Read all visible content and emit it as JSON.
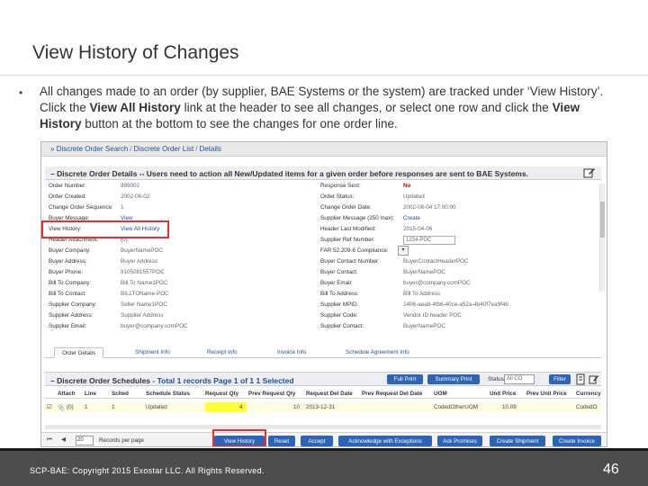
{
  "slide": {
    "title": "View History of Changes",
    "bullet_mark": "•",
    "bullet": {
      "part1": "All changes made to an order (by supplier, BAE Systems or the system) are tracked under ‘View History’.  Click the ",
      "bold1": "View All History",
      "part2": " link at the header to see all changes, or select one row and click the ",
      "bold2": "View History",
      "part3": " button at the bottom to see the changes for one order line."
    },
    "footer": {
      "copyright": "SCP-BAE: Copyright 2015 Exostar LLC. All Rights Reserved.",
      "page_number": "46"
    }
  },
  "app": {
    "breadcrumbs": [
      "Discrete Order Search",
      "Discrete Order List",
      "Details"
    ],
    "details_title": "– Discrete Order Details -- Users need to action all New/Updated items for a given order before responses are sent to BAE Systems.",
    "left_fields": [
      {
        "label": "Order Number:",
        "value": "999002"
      },
      {
        "label": "Order Created:",
        "value": "2002-06-02"
      },
      {
        "label": "Change Order Sequence:",
        "value": "1"
      },
      {
        "label": "Buyer Message:",
        "value": "View"
      },
      {
        "label": "View History:",
        "value": "View All History"
      },
      {
        "label": "Header Attachment:",
        "value": "(0)"
      },
      {
        "label": "Buyer Company:",
        "value": "BuyerNamePOC"
      },
      {
        "label": "Buyer Address:",
        "value": "Buyer Address"
      },
      {
        "label": "Buyer Phone:",
        "value": "9105081557POC"
      },
      {
        "label": "Bill To Company:",
        "value": "Bill To Name1POC"
      },
      {
        "label": "Bill To Contact:",
        "value": "BILLTOName-POC"
      },
      {
        "label": "Supplier Company:",
        "value": "Seller Name1POC"
      },
      {
        "label": "Supplier Address:",
        "value": "Supplier Address"
      },
      {
        "label": "Supplier Email:",
        "value": "buyer@company.comPOC"
      }
    ],
    "right_fields": [
      {
        "label": "Response Sent:",
        "value": "No"
      },
      {
        "label": "Order Status:",
        "value": "Updated"
      },
      {
        "label": "Change Order Date:",
        "value": "2002-06-04 17:00:00"
      },
      {
        "label": "Supplier Message (250 max):",
        "value": "Create"
      },
      {
        "label": "Header Last Modified:",
        "value": "2015-04-06"
      },
      {
        "label": "Supplier Ref Number:",
        "value": "1234-POC"
      },
      {
        "label": "FAR 52.209-6 Compliance:",
        "value": ""
      },
      {
        "label": "Buyer Contact Number:",
        "value": "BuyerContactHeaderPOC"
      },
      {
        "label": "Buyer Contact:",
        "value": "BuyerNamePOC"
      },
      {
        "label": "Buyer Email:",
        "value": "buyer@company.comPOC"
      },
      {
        "label": "Bill To Address:",
        "value": "Bill To Address"
      },
      {
        "label": "Supplier MPID:",
        "value": "1406-aea8-4fb6-40ce-a52a-4b40f7ea9f46"
      },
      {
        "label": "Supplier Code:",
        "value": "Vendor ID header POC"
      },
      {
        "label": "Supplier Contact:",
        "value": "BuyerNamePOC"
      }
    ],
    "tabs": [
      "Order Details",
      "Shipment Info",
      "Receipt Info",
      "Invoice Info",
      "Schedule Agreement Info"
    ],
    "schedules": {
      "title_bold": "– Discrete Order Schedules",
      "title_rest": " - Total 1 records Page 1 of 1  1 Selected",
      "full_print": "Full Print",
      "summary_print": "Summary Print",
      "status_label": "Status",
      "status_value": "All CO",
      "filter": "Filter"
    },
    "grid_headers": [
      "Attach",
      "Line",
      "Sched",
      "Schedule Status",
      "Request Qty",
      "Prev Request Qty",
      "Request Del Date",
      "Prev Request Del Date",
      "UOM",
      "Unit Price",
      "Prev Unit Price",
      "Currency"
    ],
    "grid_row": {
      "attach": "(0)",
      "line": "1",
      "sched": "1",
      "status": "Updated",
      "request_qty": "4",
      "prev_request_qty": "10",
      "request_del_date": "2013-12-31",
      "prev_request_del_date": "",
      "uom": "CodedOtherUOM",
      "unit_price": "10.09",
      "prev_unit_price": "",
      "currency": "CodedO"
    },
    "paging": {
      "per_page": "20",
      "label": "Records per page"
    },
    "footer_buttons": [
      "View History",
      "Reset",
      "Accept",
      "Acknowledge with Exceptions",
      "Ack Promises",
      "Create Shipment",
      "Create Invoice"
    ],
    "colors": {
      "primary_button": "#2e64b5",
      "highlight_box": "#e53030",
      "yellow_cell": "#ffff33"
    }
  }
}
